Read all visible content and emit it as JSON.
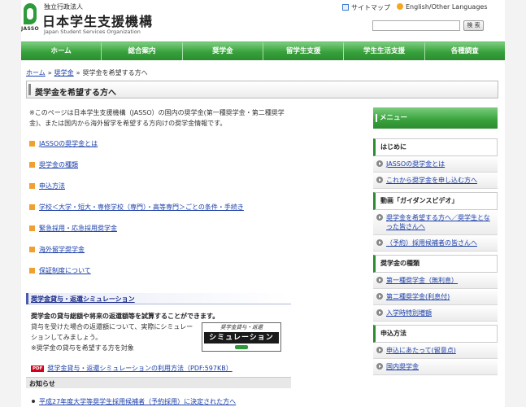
{
  "header": {
    "org_small": "独立行政法人",
    "org_name": "日本学生支援機構",
    "org_en": "Japan Student Services Organization",
    "logo_text": "JASSO",
    "sitemap": "サイトマップ",
    "english": "English/Other Languages",
    "search_placeholder": "",
    "search_button": "検 索"
  },
  "nav": [
    "ホーム",
    "総合案内",
    "奨学金",
    "留学生支援",
    "学生生活支援",
    "各種調査"
  ],
  "breadcrumb": {
    "home": "ホーム",
    "sep": "»",
    "scholarship": "奨学金",
    "current": "奨学金を希望する方へ"
  },
  "page_title": "奨学金を希望する方へ",
  "intro": "※このページは日本学生支援機構（JASSO）の国内の奨学金(第一種奨学金・第二種奨学金)、または国内から海外留学を希望する方向けの奨学金情報です。",
  "links": [
    "JASSOの奨学金とは",
    "奨学金の種類",
    "申込方法",
    "学校＜大学・短大・専修学校（専門）・高等専門＞ごとの条件・手続き",
    "緊急採用・応急採用奨学金",
    "海外留学奨学金",
    "保証制度について"
  ],
  "simulation": {
    "title": "奨学金貸与・返還シミュレーション",
    "lead": "奨学金の貸与総額や将来の返還額等を試算することができます。",
    "desc": "貸与を受けた場合の返還額について、実際にシミュレーションしてみましょう。",
    "note": "※奨学金の貸与を希望する方を対象",
    "banner_top": "奨学金貸与・返還",
    "banner_main": "シミュレーション",
    "pdf_badge": "PDF",
    "pdf_link": "奨学金貸与・返還シミュレーションの利用方法（PDF:597KB）"
  },
  "notice": {
    "title": "お知らせ",
    "item": "平成27年度大学等奨学生採用候補者（予約採用）に決定された方へ"
  },
  "sidebar": {
    "menu": "メニュー",
    "sections": [
      {
        "title": "はじめに",
        "items": [
          "JASSOの奨学金とは",
          "これから奨学金を申し込む方へ"
        ]
      },
      {
        "title": "動画「ガイダンスビデオ」",
        "items": [
          "奨学金を希望する方へ／奨学生となった皆さんへ",
          "（予約）採用候補者の皆さんへ"
        ]
      },
      {
        "title": "奨学金の種類",
        "items": [
          "第一種奨学金（無利息）",
          "第二種奨学金(利息付)",
          "入学時特別増額"
        ]
      },
      {
        "title": "申込方法",
        "items": [
          "申込にあたって(留意点)",
          "国内奨学金"
        ]
      }
    ]
  }
}
